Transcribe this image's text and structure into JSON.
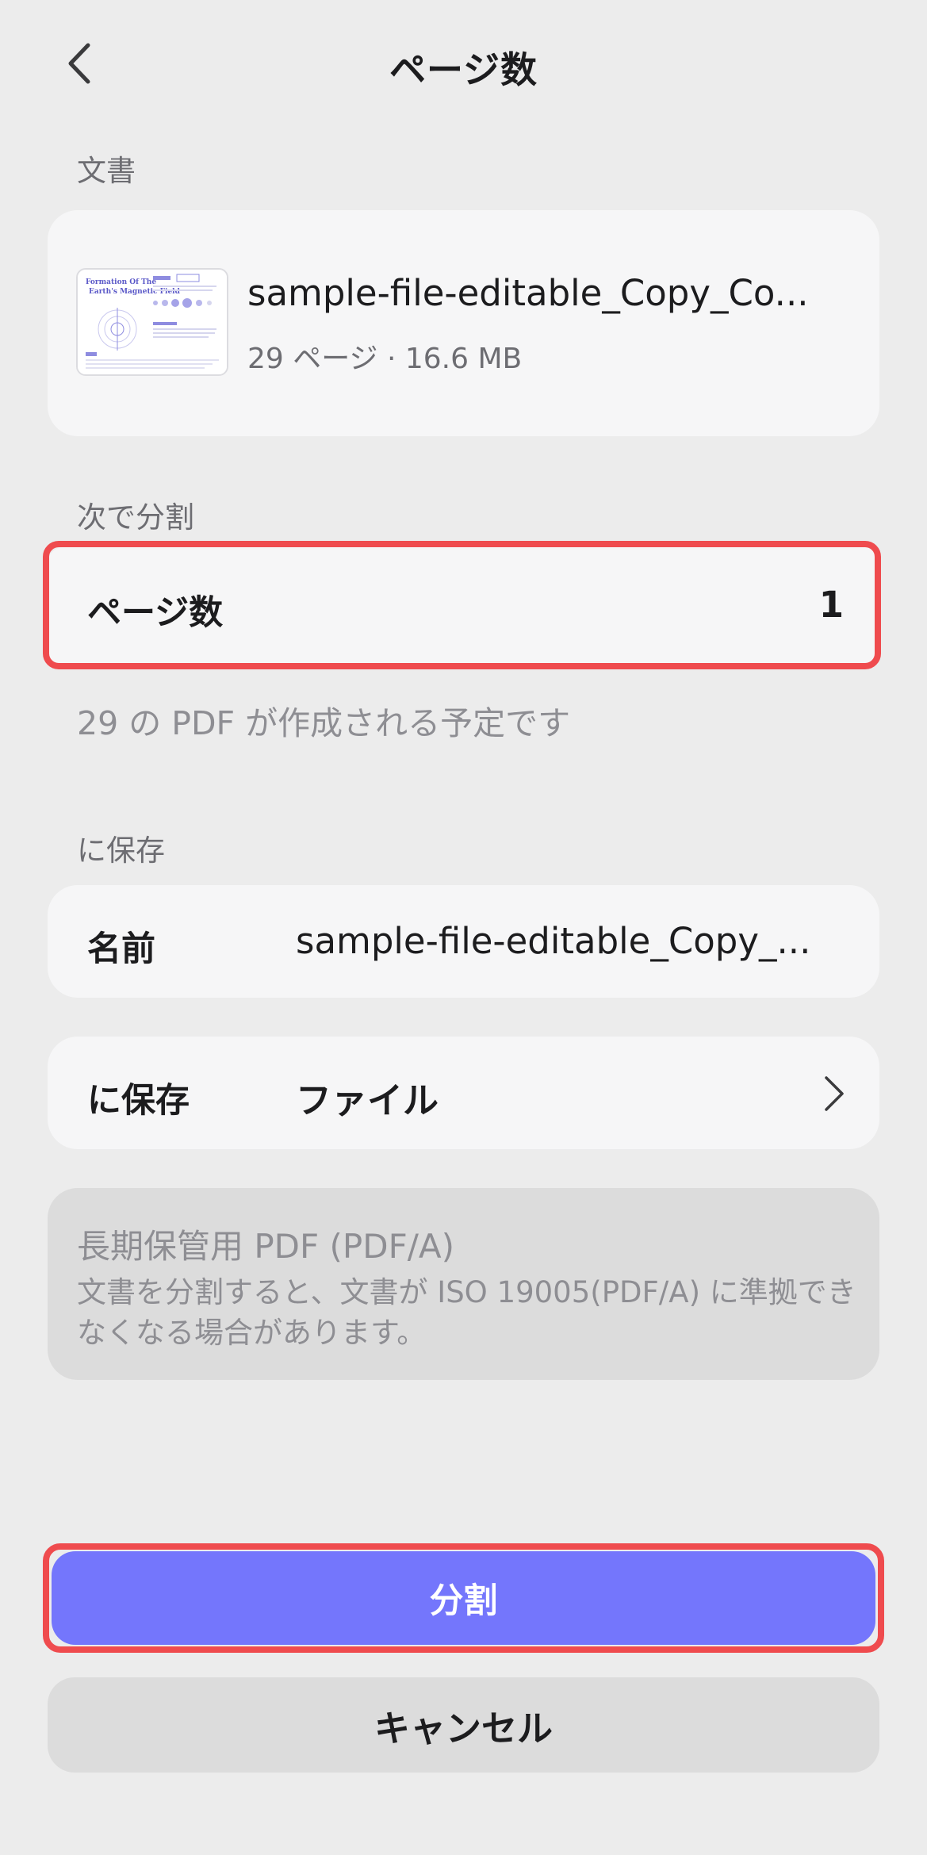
{
  "header": {
    "title": "ページ数",
    "back_icon": "chevron-left-icon"
  },
  "document_section": {
    "label": "文書",
    "file_name": "sample-file-editable_Copy_Co...",
    "meta": "29 ページ · 16.6 MB",
    "thumbnail": {
      "title_line1": "Formation Of The",
      "title_line2": "Earth's Magnetic Field"
    }
  },
  "split_section": {
    "label": "次で分割",
    "row_label": "ページ数",
    "row_value": "1",
    "hint": "29 の PDF が作成される予定です"
  },
  "save_section": {
    "label": "に保存",
    "name_label": "名前",
    "name_value": "sample-file-editable_Copy_...",
    "location_label": "に保存",
    "location_value": "ファイル",
    "chevron_icon": "chevron-right-icon"
  },
  "pdfa_notice": {
    "title": "長期保管用 PDF (PDF/A)",
    "description": "文書を分割すると、文書が ISO 19005(PDF/A) に準拠できなくなる場合があります。"
  },
  "actions": {
    "split_label": "分割",
    "cancel_label": "キャンセル"
  },
  "colors": {
    "background": "#ececec",
    "card": "#f6f6f7",
    "primary": "#7476fc",
    "highlight": "#ef4b4e",
    "muted_card": "#dcdcdc"
  }
}
